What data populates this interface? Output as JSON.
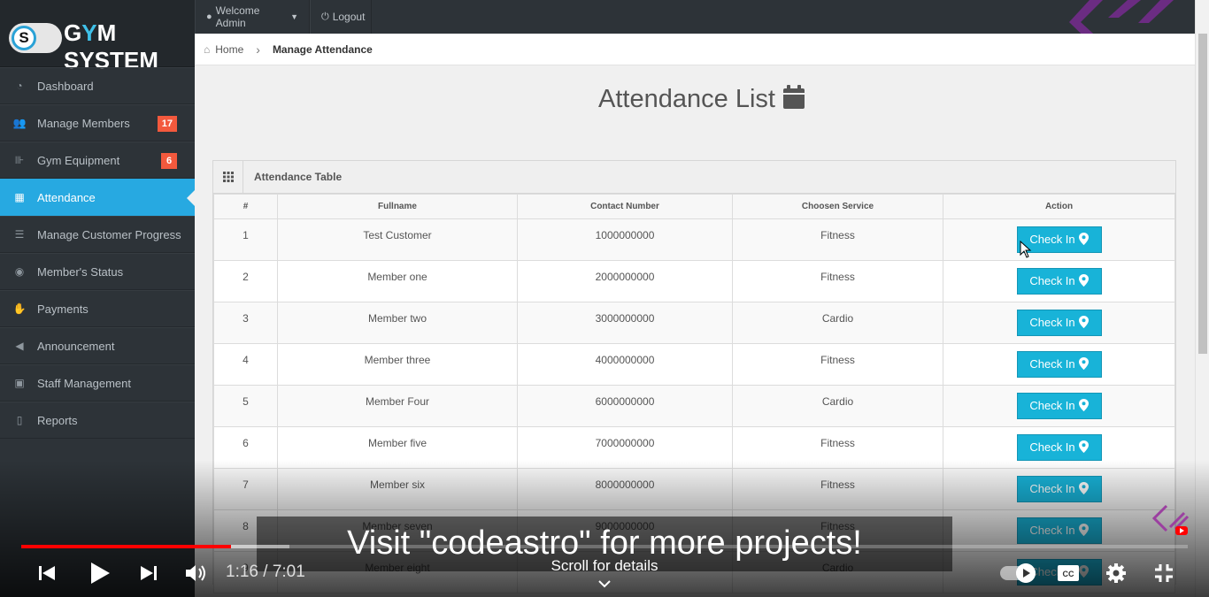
{
  "brand": {
    "prefix": "G",
    "highlight": "Y",
    "suffix": "M SYSTEM",
    "toggle_letter": "S"
  },
  "sidebar": {
    "items": [
      {
        "label": "Dashboard",
        "icon": "dashboard-icon",
        "badge": "",
        "active": false
      },
      {
        "label": "Manage Members",
        "icon": "users-icon",
        "badge": "17",
        "active": false
      },
      {
        "label": "Gym Equipment",
        "icon": "dumbbell-icon",
        "badge": "6",
        "active": false
      },
      {
        "label": "Attendance",
        "icon": "calendar-icon",
        "badge": "",
        "active": true
      },
      {
        "label": "Manage Customer Progress",
        "icon": "list-icon",
        "badge": "",
        "active": false
      },
      {
        "label": "Member's Status",
        "icon": "eye-icon",
        "badge": "",
        "active": false
      },
      {
        "label": "Payments",
        "icon": "hand-money-icon",
        "badge": "",
        "active": false
      },
      {
        "label": "Announcement",
        "icon": "bullhorn-icon",
        "badge": "",
        "active": false
      },
      {
        "label": "Staff Management",
        "icon": "briefcase-icon",
        "badge": "",
        "active": false
      },
      {
        "label": "Reports",
        "icon": "file-icon",
        "badge": "",
        "active": false
      }
    ]
  },
  "topbar": {
    "welcome": "Welcome Admin",
    "logout": "Logout"
  },
  "breadcrumb": {
    "home": "Home",
    "current": "Manage Attendance"
  },
  "page": {
    "title": "Attendance List"
  },
  "widget": {
    "title": "Attendance Table"
  },
  "table": {
    "headers": [
      "#",
      "Fullname",
      "Contact Number",
      "Choosen Service",
      "Action"
    ],
    "rows": [
      {
        "num": "1",
        "name": "Test Customer",
        "contact": "1000000000",
        "service": "Fitness"
      },
      {
        "num": "2",
        "name": "Member one",
        "contact": "2000000000",
        "service": "Fitness"
      },
      {
        "num": "3",
        "name": "Member two",
        "contact": "3000000000",
        "service": "Cardio"
      },
      {
        "num": "4",
        "name": "Member three",
        "contact": "4000000000",
        "service": "Fitness"
      },
      {
        "num": "5",
        "name": "Member Four",
        "contact": "6000000000",
        "service": "Cardio"
      },
      {
        "num": "6",
        "name": "Member five",
        "contact": "7000000000",
        "service": "Fitness"
      },
      {
        "num": "7",
        "name": "Member six",
        "contact": "8000000000",
        "service": "Fitness"
      },
      {
        "num": "8",
        "name": "Member seven",
        "contact": "9000000000",
        "service": "Fitness"
      },
      {
        "num": "9",
        "name": "Member eight",
        "contact": "",
        "service": "Cardio"
      }
    ],
    "action_label": "Check In"
  },
  "video": {
    "caption": "Visit \"codeastro\" for more projects!",
    "time": "1:16 / 7:01",
    "scroll_hint": "Scroll for details",
    "played_fraction": 0.18,
    "loaded_fraction": 0.23
  },
  "colors": {
    "accent": "#27a9e1",
    "badge": "#f3593d",
    "button": "#18b3d8",
    "sidebar": "#2d3338",
    "progress": "#ff0000"
  }
}
